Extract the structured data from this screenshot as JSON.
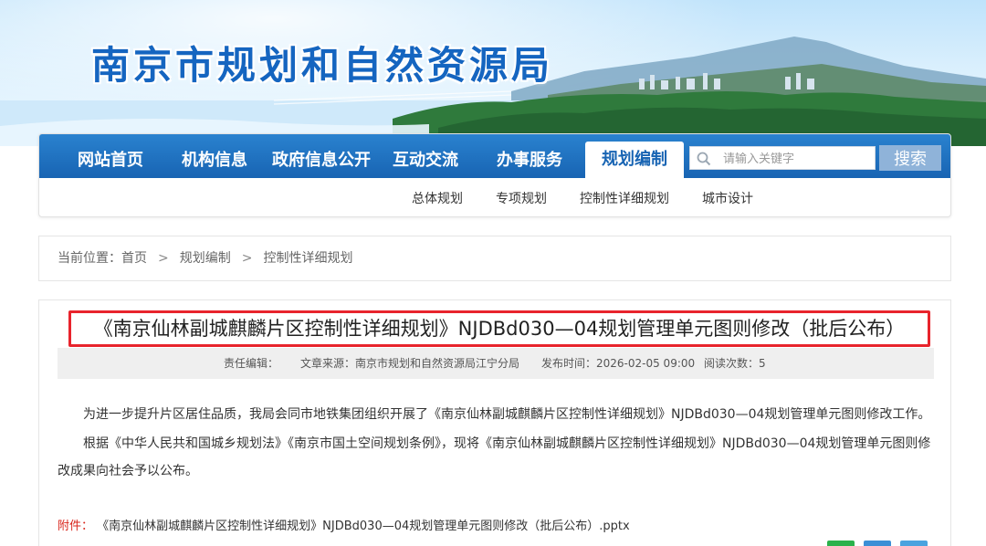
{
  "header": {
    "site_title": "南京市规划和自然资源局"
  },
  "nav": {
    "items": [
      {
        "label": "网站首页"
      },
      {
        "label": "机构信息"
      },
      {
        "label": "政府信息公开"
      },
      {
        "label": "互动交流"
      },
      {
        "label": "办事服务"
      },
      {
        "label": "规划编制",
        "active": true
      }
    ],
    "search": {
      "placeholder": "请输入关键字",
      "button_label": "搜索",
      "icon": "search-icon"
    },
    "sub_items": [
      {
        "label": "总体规划"
      },
      {
        "label": "专项规划"
      },
      {
        "label": "控制性详细规划"
      },
      {
        "label": "城市设计"
      }
    ],
    "colors": {
      "bar": "#1864b3",
      "active_text": "#1864b3"
    }
  },
  "breadcrumb": {
    "prefix": "当前位置：",
    "items": [
      "首页",
      "规划编制",
      "控制性详细规划"
    ],
    "separator": ">"
  },
  "article": {
    "title": "《南京仙林副城麒麟片区控制性详细规划》NJDBd030—04规划管理单元图则修改（批后公布）",
    "title_highlight_color": "#e8242c",
    "meta": {
      "editor": "责任编辑：",
      "source": "文章来源：南京市规划和自然资源局江宁分局",
      "published": "发布时间：2026-02-05 09:00",
      "views": "阅读次数：5"
    },
    "paragraphs": [
      "为进一步提升片区居住品质，我局会同市地铁集团组织开展了《南京仙林副城麒麟片区控制性详细规划》NJDBd030—04规划管理单元图则修改工作。",
      "根据《中华人民共和国城乡规划法》《南京市国土空间规划条例》，现将《南京仙林副城麒麟片区控制性详细规划》NJDBd030—04规划管理单元图则修改成果向社会予以公布。"
    ],
    "attachment": {
      "label": "附件：",
      "file": "《南京仙林副城麒麟片区控制性详细规划》NJDBd030—04规划管理单元图则修改（批后公布）.pptx",
      "label_color": "#d9261c"
    }
  }
}
